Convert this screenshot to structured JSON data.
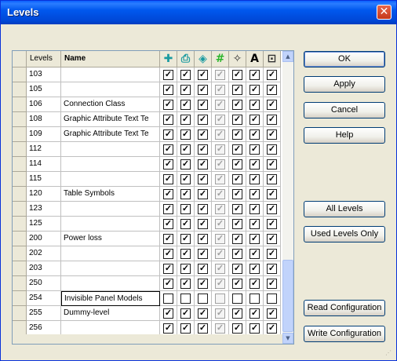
{
  "window": {
    "title": "Levels",
    "close_glyph": "✕"
  },
  "grid": {
    "headers": {
      "levels": "Levels",
      "name": "Name"
    },
    "icon_columns": [
      {
        "icon": "display-icon",
        "glyph": "✚",
        "color": "#1a9aa0"
      },
      {
        "icon": "plot-icon",
        "glyph": "⎙",
        "color": "#1a9aa0"
      },
      {
        "icon": "lock-icon",
        "glyph": "◈",
        "color": "#1a9aa0"
      },
      {
        "icon": "grid-icon",
        "glyph": "#",
        "color": "#2bb52b"
      },
      {
        "icon": "snap-icon",
        "glyph": "✧",
        "color": "#333333"
      },
      {
        "icon": "text-icon",
        "glyph": "A",
        "color": "#000000"
      },
      {
        "icon": "reference-icon",
        "glyph": "⊡",
        "color": "#333333"
      }
    ],
    "rows": [
      {
        "level": "103",
        "name": "",
        "checks": [
          true,
          true,
          true,
          true,
          true,
          true,
          true
        ]
      },
      {
        "level": "105",
        "name": "",
        "checks": [
          true,
          true,
          true,
          true,
          true,
          true,
          true
        ]
      },
      {
        "level": "106",
        "name": "Connection Class",
        "checks": [
          true,
          true,
          true,
          true,
          true,
          true,
          true
        ]
      },
      {
        "level": "108",
        "name": "Graphic Attribute Text Te",
        "checks": [
          true,
          true,
          true,
          true,
          true,
          true,
          true
        ]
      },
      {
        "level": "109",
        "name": "Graphic Attribute Text Te",
        "checks": [
          true,
          true,
          true,
          true,
          true,
          true,
          true
        ]
      },
      {
        "level": "112",
        "name": "",
        "checks": [
          true,
          true,
          true,
          true,
          true,
          true,
          true
        ]
      },
      {
        "level": "114",
        "name": "",
        "checks": [
          true,
          true,
          true,
          true,
          true,
          true,
          true
        ]
      },
      {
        "level": "115",
        "name": "",
        "checks": [
          true,
          true,
          true,
          true,
          true,
          true,
          true
        ]
      },
      {
        "level": "120",
        "name": "Table Symbols",
        "checks": [
          true,
          true,
          true,
          true,
          true,
          true,
          true
        ]
      },
      {
        "level": "123",
        "name": "",
        "checks": [
          true,
          true,
          true,
          true,
          true,
          true,
          true
        ]
      },
      {
        "level": "125",
        "name": "",
        "checks": [
          true,
          true,
          true,
          true,
          true,
          true,
          true
        ]
      },
      {
        "level": "200",
        "name": "Power loss",
        "checks": [
          true,
          true,
          true,
          true,
          true,
          true,
          true
        ]
      },
      {
        "level": "202",
        "name": "",
        "checks": [
          true,
          true,
          true,
          true,
          true,
          true,
          true
        ]
      },
      {
        "level": "203",
        "name": "",
        "checks": [
          true,
          true,
          true,
          true,
          true,
          true,
          true
        ]
      },
      {
        "level": "250",
        "name": "",
        "checks": [
          true,
          true,
          true,
          true,
          true,
          true,
          true
        ]
      },
      {
        "level": "254",
        "name": "Invisible Panel Models",
        "checks": [
          false,
          false,
          false,
          false,
          false,
          false,
          false
        ]
      },
      {
        "level": "255",
        "name": "Dummy-level",
        "checks": [
          true,
          true,
          true,
          true,
          true,
          true,
          true
        ]
      },
      {
        "level": "256",
        "name": "",
        "checks": [
          true,
          true,
          true,
          true,
          true,
          true,
          true
        ]
      }
    ]
  },
  "buttons": {
    "ok": "OK",
    "apply": "Apply",
    "cancel": "Cancel",
    "help": "Help",
    "all_levels": "All Levels",
    "used_levels_only": "Used Levels Only",
    "read_configuration": "Read Configuration",
    "write_configuration": "Write Configuration"
  },
  "scrollbar": {
    "up_glyph": "▲",
    "down_glyph": "▼"
  }
}
